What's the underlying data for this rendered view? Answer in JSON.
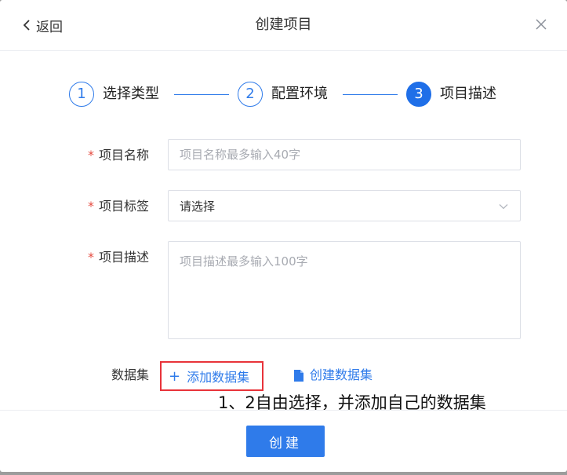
{
  "header": {
    "back_label": "返回",
    "title": "创建项目"
  },
  "steps": [
    {
      "number": "1",
      "label": "选择类型",
      "state": "done"
    },
    {
      "number": "2",
      "label": "配置环境",
      "state": "done"
    },
    {
      "number": "3",
      "label": "项目描述",
      "state": "active"
    }
  ],
  "form": {
    "required_mark": "*",
    "name": {
      "label": "项目名称",
      "value": "",
      "placeholder": "项目名称最多输入40字"
    },
    "tags": {
      "label": "项目标签",
      "value": "请选择"
    },
    "description": {
      "label": "项目描述",
      "value": "",
      "placeholder": "项目描述最多输入100字"
    },
    "dataset": {
      "label": "数据集",
      "add_label": "添加数据集",
      "create_label": "创建数据集"
    }
  },
  "annotation": "1、2自由选择，并添加自己的数据集",
  "footer": {
    "submit_label": "创建"
  },
  "colors": {
    "accent": "#2f7bea",
    "highlight_border": "#e8333a",
    "required": "#e54d42"
  },
  "icons": [
    "chevron-left-icon",
    "close-icon",
    "chevron-down-icon",
    "plus-icon",
    "file-icon"
  ]
}
